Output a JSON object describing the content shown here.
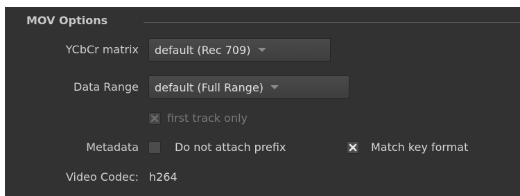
{
  "section": {
    "title": "MOV Options"
  },
  "ycbcr": {
    "label": "YCbCr matrix",
    "value": "default (Rec 709)"
  },
  "data_range": {
    "label": "Data Range",
    "value": "default (Full Range)"
  },
  "first_track": {
    "label": "first track only",
    "checked": true,
    "enabled": false
  },
  "metadata": {
    "label": "Metadata",
    "do_not_attach_prefix": {
      "label": "Do not attach prefix",
      "checked": false
    },
    "match_key_format": {
      "label": "Match key format",
      "checked": true
    }
  },
  "video_codec": {
    "label": "Video Codec:",
    "value": "h264"
  },
  "colors": {
    "panel_bg": "#323232",
    "dropdown_bg": "#464646",
    "text": "#d4d4d4",
    "disabled_text": "#7a7a7a"
  }
}
